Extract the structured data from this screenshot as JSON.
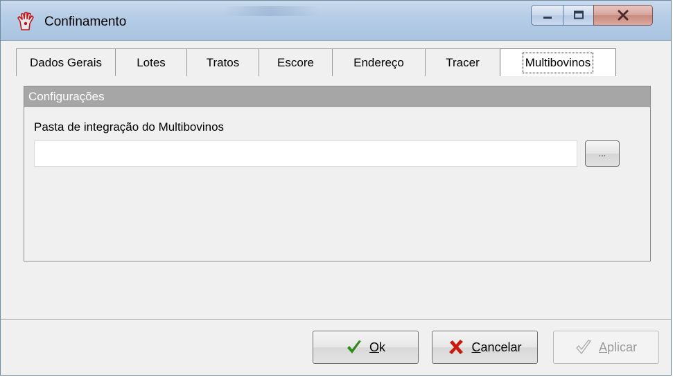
{
  "window": {
    "title": "Confinamento",
    "title_icon": "app-hand-icon",
    "controls": [
      "minimize-icon",
      "maximize-icon",
      "close-icon"
    ]
  },
  "tabs": [
    {
      "label": "Dados Gerais",
      "active": false
    },
    {
      "label": "Lotes",
      "active": false
    },
    {
      "label": "Tratos",
      "active": false
    },
    {
      "label": "Escore",
      "active": false
    },
    {
      "label": "Endereço",
      "active": false
    },
    {
      "label": "Tracer",
      "active": false
    },
    {
      "label": "Multibovinos",
      "active": true
    }
  ],
  "group": {
    "header": "Configurações",
    "field_label": "Pasta de integração do Multibovinos",
    "field_value": "",
    "browse_label": "..."
  },
  "buttons": {
    "ok": {
      "mnemonic": "O",
      "rest": "k",
      "icon": "checkmark-icon"
    },
    "cancel": {
      "mnemonic": "C",
      "rest": "ancelar",
      "icon": "x-icon"
    },
    "apply": {
      "mnemonic": "A",
      "rest": "plicar",
      "icon": "checkmark-outline-icon",
      "enabled": false
    }
  },
  "colors": {
    "group_header_bg": "#a6a6a6",
    "ok_check": "#2e8b1e",
    "cancel_x": "#c81a0f"
  }
}
